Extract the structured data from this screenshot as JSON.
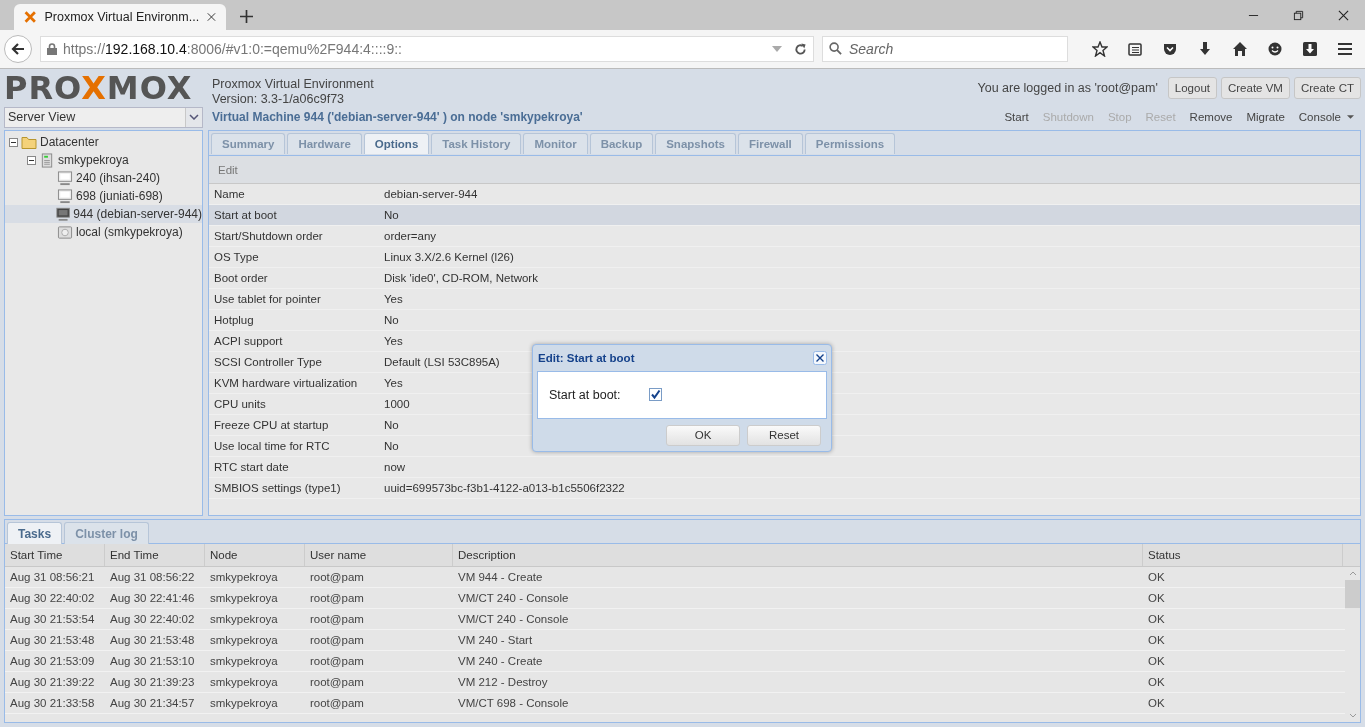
{
  "browser": {
    "tab": {
      "title": "Proxmox Virtual Environm..."
    },
    "url": {
      "scheme": "https://",
      "host": "192.168.10.4",
      "rest": ":8006/#v1:0:=qemu%2F944:4::::9::"
    },
    "search": {
      "placeholder": "Search"
    }
  },
  "header": {
    "logo": [
      {
        "text": "PRO",
        "accent": false
      },
      {
        "text": "X",
        "accent": true
      },
      {
        "text": "MOX",
        "accent": false
      }
    ],
    "product": "Proxmox Virtual Environment",
    "version": "Version: 3.3-1/a06c9f73",
    "login": "You are logged in as 'root@pam'",
    "buttons": [
      "Logout",
      "Create VM",
      "Create CT"
    ]
  },
  "sidebar": {
    "view": "Server View",
    "tree": [
      {
        "label": "Datacenter",
        "kind": "datacenter",
        "expanded": true,
        "selected": false,
        "children": [
          {
            "label": "smkypekroya",
            "kind": "node",
            "expanded": true,
            "selected": false,
            "children": [
              {
                "label": "240 (ihsan-240)",
                "kind": "vm",
                "running": false,
                "selected": false
              },
              {
                "label": "698 (juniati-698)",
                "kind": "vm",
                "running": false,
                "selected": false
              },
              {
                "label": "944 (debian-server-944)",
                "kind": "vm",
                "running": false,
                "selected": true
              },
              {
                "label": "local (smkypekroya)",
                "kind": "storage",
                "selected": false
              }
            ]
          }
        ]
      }
    ]
  },
  "content": {
    "title": "Virtual Machine 944 ('debian-server-944' ) on node 'smkypekroya'",
    "actions": [
      {
        "label": "Start",
        "disabled": false
      },
      {
        "label": "Shutdown",
        "disabled": true
      },
      {
        "label": "Stop",
        "disabled": true
      },
      {
        "label": "Reset",
        "disabled": true
      },
      {
        "label": "Remove",
        "disabled": false
      },
      {
        "label": "Migrate",
        "disabled": false
      },
      {
        "label": "Console",
        "disabled": false,
        "menu": true
      }
    ],
    "tabs": [
      {
        "label": "Summary",
        "selected": false
      },
      {
        "label": "Hardware",
        "selected": false
      },
      {
        "label": "Options",
        "selected": true
      },
      {
        "label": "Task History",
        "selected": false
      },
      {
        "label": "Monitor",
        "selected": false
      },
      {
        "label": "Backup",
        "selected": false
      },
      {
        "label": "Snapshots",
        "selected": false
      },
      {
        "label": "Firewall",
        "selected": false
      },
      {
        "label": "Permissions",
        "selected": false
      }
    ],
    "toolbar": [
      "Edit"
    ],
    "options": [
      {
        "name": "Name",
        "value": "debian-server-944",
        "selected": false
      },
      {
        "name": "Start at boot",
        "value": "No",
        "selected": true
      },
      {
        "name": "Start/Shutdown order",
        "value": "order=any",
        "selected": false
      },
      {
        "name": "OS Type",
        "value": "Linux 3.X/2.6 Kernel (l26)",
        "selected": false
      },
      {
        "name": "Boot order",
        "value": "Disk 'ide0', CD-ROM, Network",
        "selected": false
      },
      {
        "name": "Use tablet for pointer",
        "value": "Yes",
        "selected": false
      },
      {
        "name": "Hotplug",
        "value": "No",
        "selected": false
      },
      {
        "name": "ACPI support",
        "value": "Yes",
        "selected": false
      },
      {
        "name": "SCSI Controller Type",
        "value": "Default (LSI 53C895A)",
        "selected": false
      },
      {
        "name": "KVM hardware virtualization",
        "value": "Yes",
        "selected": false
      },
      {
        "name": "CPU units",
        "value": "1000",
        "selected": false
      },
      {
        "name": "Freeze CPU at startup",
        "value": "No",
        "selected": false
      },
      {
        "name": "Use local time for RTC",
        "value": "No",
        "selected": false
      },
      {
        "name": "RTC start date",
        "value": "now",
        "selected": false
      },
      {
        "name": "SMBIOS settings (type1)",
        "value": "uuid=699573bc-f3b1-4122-a013-b1c5506f2322",
        "selected": false
      }
    ]
  },
  "dialog": {
    "title": "Edit: Start at boot",
    "field": {
      "label": "Start at boot:",
      "checked": true
    },
    "buttons": [
      "OK",
      "Reset"
    ]
  },
  "log_panel": {
    "tabs": [
      {
        "label": "Tasks",
        "selected": true
      },
      {
        "label": "Cluster log",
        "selected": false
      }
    ],
    "columns": [
      "Start Time",
      "End Time",
      "Node",
      "User name",
      "Description",
      "Status"
    ],
    "rows": [
      [
        "Aug 31 08:56:21",
        "Aug 31 08:56:22",
        "smkypekroya",
        "root@pam",
        "VM 944 - Create",
        "OK"
      ],
      [
        "Aug 30 22:40:02",
        "Aug 30 22:41:46",
        "smkypekroya",
        "root@pam",
        "VM/CT 240 - Console",
        "OK"
      ],
      [
        "Aug 30 21:53:54",
        "Aug 30 22:40:02",
        "smkypekroya",
        "root@pam",
        "VM/CT 240 - Console",
        "OK"
      ],
      [
        "Aug 30 21:53:48",
        "Aug 30 21:53:48",
        "smkypekroya",
        "root@pam",
        "VM 240 - Start",
        "OK"
      ],
      [
        "Aug 30 21:53:09",
        "Aug 30 21:53:10",
        "smkypekroya",
        "root@pam",
        "VM 240 - Create",
        "OK"
      ],
      [
        "Aug 30 21:39:22",
        "Aug 30 21:39:23",
        "smkypekroya",
        "root@pam",
        "VM 212 - Destroy",
        "OK"
      ],
      [
        "Aug 30 21:33:58",
        "Aug 30 21:34:57",
        "smkypekroya",
        "root@pam",
        "VM/CT 698 - Console",
        "OK"
      ]
    ]
  }
}
